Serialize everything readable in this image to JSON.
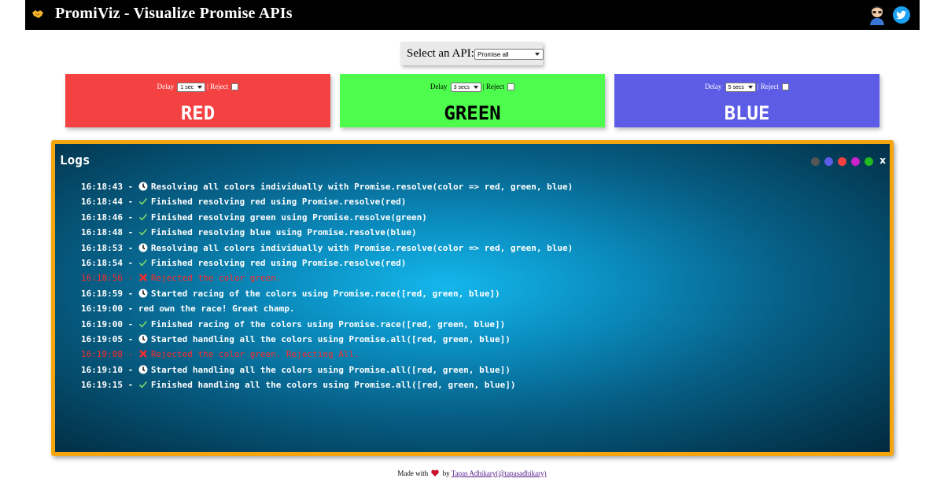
{
  "header": {
    "title": "PromiViz - Visualize Promise APIs",
    "logo_icon": "handshake-icon",
    "avatar_icon": "author-avatar-icon",
    "social_icon": "twitter-icon"
  },
  "api_selector": {
    "label": "Select an API:",
    "selected": "Promise all"
  },
  "cards": [
    {
      "color_label": "RED",
      "delay_label": "Delay",
      "delay_value": "1 sec",
      "reject_label": "| Reject",
      "reject_checked": false,
      "bg": "#f44141"
    },
    {
      "color_label": "GREEN",
      "delay_label": "Delay",
      "delay_value": "3 secs",
      "reject_label": "| Reject",
      "reject_checked": false,
      "bg": "#4dfc4d"
    },
    {
      "color_label": "BLUE",
      "delay_label": "Delay",
      "delay_value": "5 secs",
      "reject_label": "| Reject",
      "reject_checked": false,
      "bg": "#5c5ce6"
    }
  ],
  "logs": {
    "title": "Logs",
    "close_label": "x",
    "theme_dots": [
      "#555555",
      "#5c5ce6",
      "#f44141",
      "#cc22cc",
      "#22bb22"
    ],
    "entries": [
      {
        "time": "16:18:43",
        "icon": "clock-icon",
        "status": "info",
        "message": "Resolving all colors individually with Promise.resolve(color => red, green, blue)"
      },
      {
        "time": "16:18:44",
        "icon": "check-icon",
        "status": "success",
        "message": "Finished resolving red using Promise.resolve(red)"
      },
      {
        "time": "16:18:46",
        "icon": "check-icon",
        "status": "success",
        "message": "Finished resolving green using Promise.resolve(green)"
      },
      {
        "time": "16:18:48",
        "icon": "check-icon",
        "status": "success",
        "message": "Finished resolving blue using Promise.resolve(blue)"
      },
      {
        "time": "16:18:53",
        "icon": "clock-icon",
        "status": "info",
        "message": "Resolving all colors individually with Promise.resolve(color => red, green, blue)"
      },
      {
        "time": "16:18:54",
        "icon": "check-icon",
        "status": "success",
        "message": "Finished resolving red using Promise.resolve(red)"
      },
      {
        "time": "16:18:56",
        "icon": "cross-icon",
        "status": "error",
        "message": "Rejected the color green."
      },
      {
        "time": "16:18:59",
        "icon": "clock-icon",
        "status": "info",
        "message": "Started racing of the colors using Promise.race([red, green, blue])"
      },
      {
        "time": "16:19:00",
        "icon": "",
        "status": "plain",
        "message": "red own the race! Great champ."
      },
      {
        "time": "16:19:00",
        "icon": "check-icon",
        "status": "success",
        "message": "Finished racing of the colors using Promise.race([red, green, blue])"
      },
      {
        "time": "16:19:05",
        "icon": "clock-icon",
        "status": "info",
        "message": "Started handling all the colors using Promise.all([red, green, blue])"
      },
      {
        "time": "16:19:08",
        "icon": "cross-icon",
        "status": "error",
        "message": "Rejected the color green. Rejecting All."
      },
      {
        "time": "16:19:10",
        "icon": "clock-icon",
        "status": "info",
        "message": "Started handling all the colors using Promise.all([red, green, blue])"
      },
      {
        "time": "16:19:15",
        "icon": "check-icon",
        "status": "success",
        "message": "Finished handling all the colors using Promise.all([red, green, blue])"
      }
    ]
  },
  "footer": {
    "made_with": "Made with",
    "by": "by",
    "author_link": "Tapas Adhikary(@tapasadhikary)"
  }
}
